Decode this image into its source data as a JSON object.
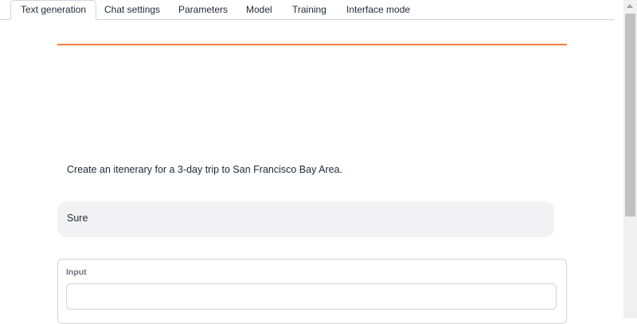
{
  "tabs": [
    {
      "label": "Text generation",
      "active": true
    },
    {
      "label": "Chat settings"
    },
    {
      "label": "Parameters"
    },
    {
      "label": "Model"
    },
    {
      "label": "Training"
    },
    {
      "label": "Interface mode"
    }
  ],
  "chat": {
    "user_message": "Create an itenerary for a 3-day trip to San Francisco Bay Area.",
    "bot_message": "Sure"
  },
  "input": {
    "label": "Input",
    "value": ""
  },
  "colors": {
    "accent": "#f47c3c",
    "bot_bubble": "#f2f1f3"
  }
}
